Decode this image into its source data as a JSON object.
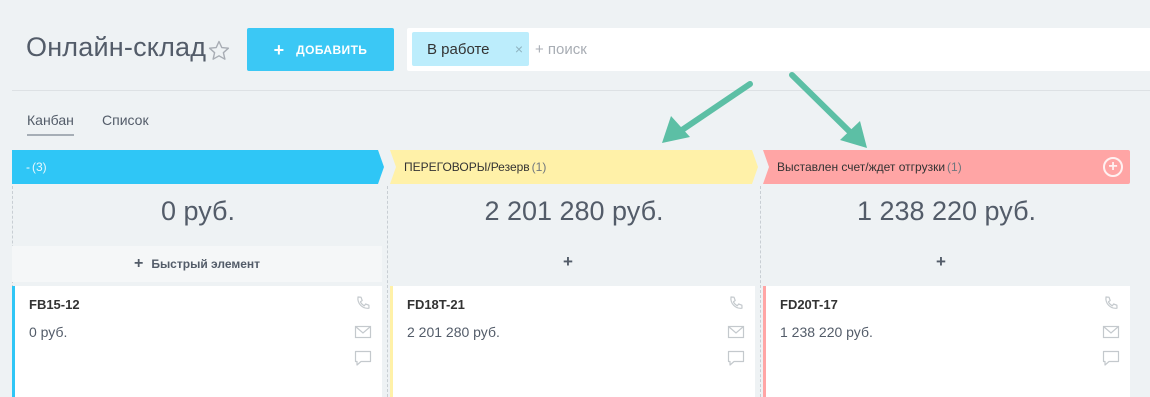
{
  "header": {
    "title": "Онлайн-склад",
    "add_button_label": "ДОБАВИТЬ",
    "add_button_icon": "+",
    "filter": {
      "tag": "В работе",
      "tag_close": "×",
      "search_placeholder": "+ поиск"
    }
  },
  "tabs": [
    {
      "label": "Канбан",
      "active": true
    },
    {
      "label": "Список",
      "active": false
    }
  ],
  "columns": [
    {
      "title": "-",
      "count": "(3)",
      "color": "#2fc6f6",
      "total": "0 руб.",
      "quick_add": "Быстрый элемент",
      "quick_add_icon": "+",
      "cards": [
        {
          "title": "FB15-12",
          "sum": "0 руб.",
          "accent": "#2fc6f6"
        }
      ]
    },
    {
      "title": "ПЕРЕГОВОРЫ/Резерв",
      "count": "(1)",
      "color": "#fff1a8",
      "total": "2 201 280 руб.",
      "add_icon": "+",
      "cards": [
        {
          "title": "FD18T-21",
          "sum": "2 201 280 руб.",
          "accent": "#fff1a8"
        }
      ]
    },
    {
      "title": "Выставлен счет/ждет отгрузки",
      "count": "(1)",
      "color": "#ffa5a5",
      "total": "1 238 220 руб.",
      "add_icon": "+",
      "header_add_icon": "+",
      "cards": [
        {
          "title": "FD20T-17",
          "sum": "1 238 220 руб.",
          "accent": "#ffa5a5"
        }
      ]
    }
  ],
  "colors": {
    "accent": "#3bc8f5",
    "annotation_arrow": "#5cbfa5"
  },
  "icons": [
    "star-icon",
    "phone-icon",
    "mail-icon",
    "chat-icon",
    "arrow-annotation"
  ]
}
